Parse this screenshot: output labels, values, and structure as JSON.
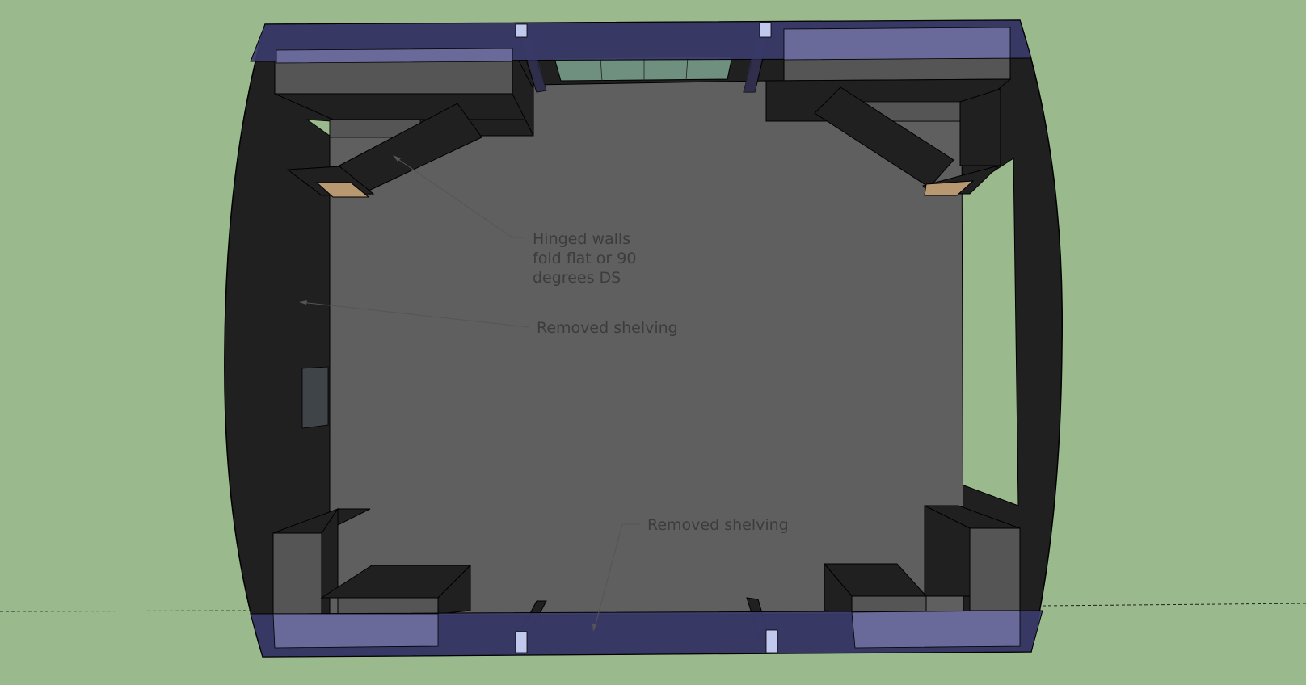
{
  "annotations": {
    "hinged_walls": [
      "Hinged walls",
      "fold flat or 90",
      "degrees DS"
    ],
    "removed_shelving_left": "Removed shelving",
    "removed_shelving_bottom": "Removed shelving"
  },
  "colors": {
    "background": "#9aba8d",
    "wall_dark": "#202020",
    "floor": "#5f5f5f",
    "shelf_top": "#555555",
    "glass_blue": "#3b3b6b",
    "glass_light": "#6a6a9a",
    "window_green": "#6f8f7f",
    "marker_light": "#c0c8ee",
    "plank": "#b89870"
  }
}
